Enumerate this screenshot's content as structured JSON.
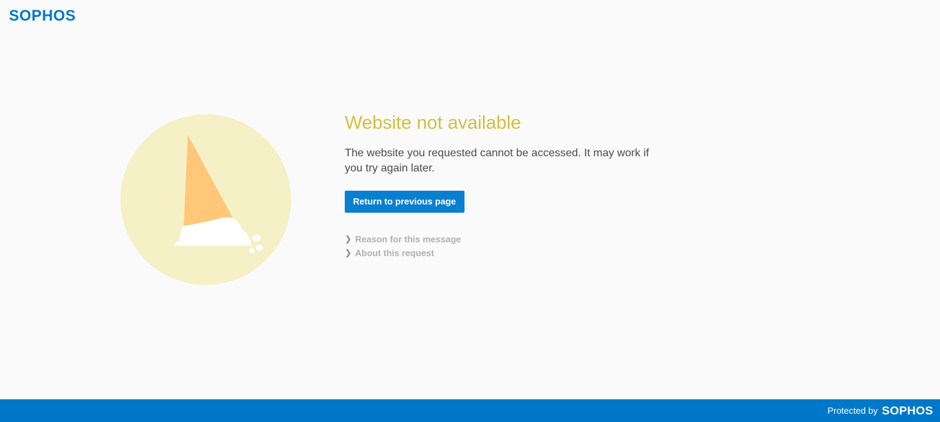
{
  "header": {
    "logo_text": "SOPHOS"
  },
  "illustration": {
    "name": "melted-ice-cream-cone",
    "colors": {
      "circle": "#f6f0c6",
      "cone": "#fec878",
      "ice_cream": "#ffffff"
    }
  },
  "main": {
    "title": "Website not available",
    "message": "The website you requested cannot be accessed. It may work if you try again later.",
    "return_button_label": "Return to previous page",
    "links": [
      {
        "label": "Reason for this message"
      },
      {
        "label": "About this request"
      }
    ]
  },
  "footer": {
    "protected_by": "Protected by",
    "logo_text": "SOPHOS"
  },
  "colors": {
    "accent": "#0078c9",
    "title": "#d2bf3f",
    "background": "#fafafa"
  }
}
